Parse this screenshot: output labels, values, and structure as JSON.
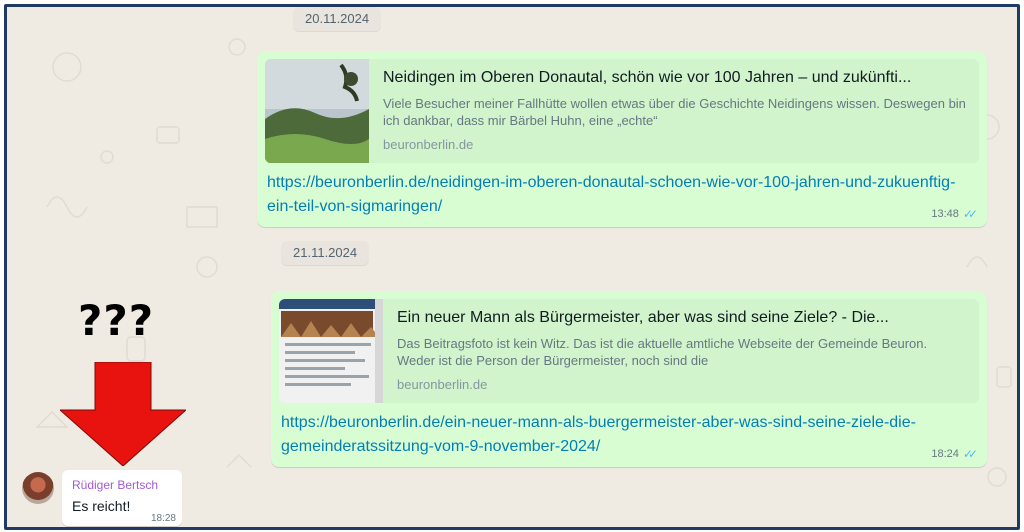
{
  "chat": {
    "dates": [
      "20.11.2024",
      "21.11.2024"
    ],
    "messages": [
      {
        "preview_title": "Neidingen im Oberen Donautal, schön wie vor 100 Jahren – und zukünfti...",
        "preview_desc": "Viele Besucher meiner Fallhütte wollen etwas über die Geschichte Neidingens wissen. Deswegen bin ich dankbar, dass mir Bärbel Huhn, eine „echte“",
        "preview_domain": "beuronberlin.de",
        "link": "https://beuronberlin.de/neidingen-im-oberen-donautal-schoen-wie-vor-100-jahren-und-zukuenftig-ein-teil-von-sigmaringen/",
        "time": "13:48"
      },
      {
        "preview_title": "Ein neuer Mann als Bürgermeister, aber was sind seine Ziele? - Die...",
        "preview_desc": "Das Beitragsfoto ist kein Witz. Das ist die aktuelle amtliche Webseite der Gemeinde Beuron. Weder ist die Person der Bürgermeister, noch sind die",
        "preview_domain": "beuronberlin.de",
        "link": "https://beuronberlin.de/ein-neuer-mann-als-buergermeister-aber-was-sind-seine-ziele-die-gemeinderatssitzung-vom-9-november-2024/",
        "time": "18:24"
      }
    ],
    "incoming": {
      "sender": "Rüdiger Bertsch",
      "text": "Es reicht!",
      "time": "18:28"
    }
  },
  "annotation": {
    "text": "???",
    "arrow_color": "#e8130f"
  },
  "colors": {
    "outgoing_bubble": "#d9fdd3",
    "link": "#027eb5",
    "read_ticks": "#53bdeb",
    "frame_border": "#1f3b64"
  }
}
